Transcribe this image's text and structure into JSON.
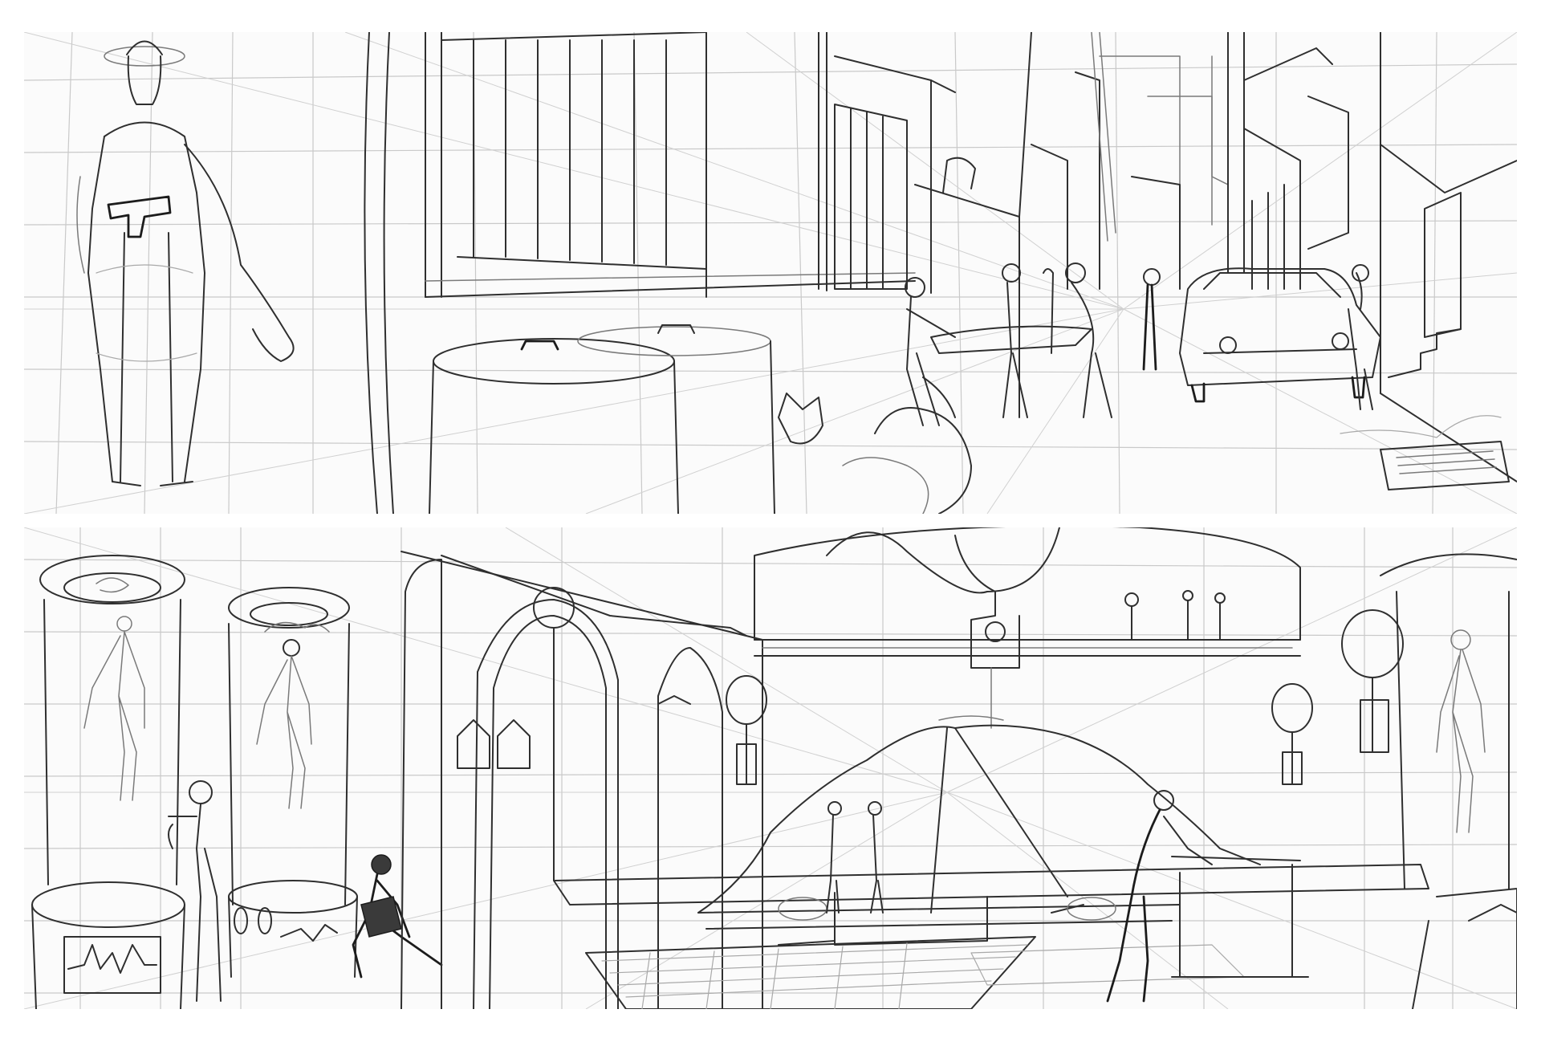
{
  "sheet": {
    "background": "#ffffff",
    "panel_background": "#fbfbfb",
    "ink_color": "#2f2f2f",
    "grid_color": "#c9c9c9",
    "panels": [
      {
        "label": "",
        "scene": "street-alley"
      },
      {
        "label": "",
        "scene": "lab-hall"
      }
    ]
  }
}
